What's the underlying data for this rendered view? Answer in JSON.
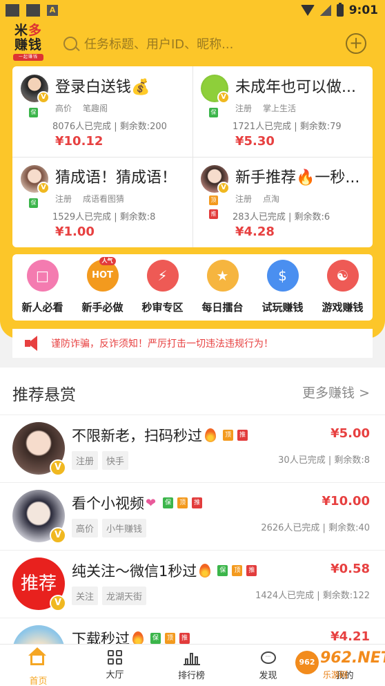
{
  "status_bar": {
    "time": "9:01"
  },
  "app": {
    "logo_line1a": "米",
    "logo_line1b": "多",
    "logo_line2": "赚钱",
    "logo_sub": "一起赚钱"
  },
  "search": {
    "placeholder": "任务标题、用户ID、昵称..."
  },
  "tasks": [
    {
      "title": "登录白送钱💰",
      "tag1": "高价",
      "tag2": "笔趣阁",
      "stats": "8076人已完成 | 剩余数:200",
      "price": "¥10.12",
      "badges": [
        "保"
      ]
    },
    {
      "title": "未成年也可以做...",
      "tag1": "注册",
      "tag2": "掌上生活",
      "stats": "1721人已完成 | 剩余数:79",
      "price": "¥5.30",
      "badges": [
        "保"
      ]
    },
    {
      "title": "猜成语！猜成语！",
      "tag1": "注册",
      "tag2": "成语看图猜",
      "stats": "1529人已完成 | 剩余数:8",
      "price": "¥1.00",
      "badges": [
        "保"
      ]
    },
    {
      "title": "新手推荐🔥一秒...",
      "tag1": "注册",
      "tag2": "点淘",
      "stats": "283人已完成 | 剩余数:6",
      "price": "¥4.28",
      "badges": [
        "顶",
        "推"
      ]
    }
  ],
  "categories": [
    {
      "label": "新人必看",
      "color": "#f47bb0"
    },
    {
      "label": "新手必做",
      "color": "#f39a1e",
      "hot": "HOT",
      "pill": "人气"
    },
    {
      "label": "秒审专区",
      "color": "#ee5a55"
    },
    {
      "label": "每日擂台",
      "color": "#f6b53f"
    },
    {
      "label": "试玩赚钱",
      "color": "#4a8ff0"
    },
    {
      "label": "游戏赚钱",
      "color": "#ee5a55"
    }
  ],
  "notice": {
    "text": "谨防诈骗，反诈须知！严厉打击一切违法违规行为！"
  },
  "recommend": {
    "title": "推荐悬赏",
    "more": "更多赚钱 >",
    "items": [
      {
        "title": "不限新老，扫码秒过",
        "tag1": "注册",
        "tag2": "快手",
        "price": "¥5.00",
        "stats": "30人已完成 | 剩余数:8",
        "badges": [
          "顶",
          "推"
        ]
      },
      {
        "title": "看个小视频",
        "tag1": "高价",
        "tag2": "小牛赚钱",
        "price": "¥10.00",
        "stats": "2626人已完成 | 剩余数:40",
        "badges": [
          "保",
          "顶",
          "推"
        ]
      },
      {
        "title": "纯关注～微信1秒过",
        "tag1": "关注",
        "tag2": "龙湖天街",
        "price": "¥0.58",
        "stats": "1424人已完成 | 剩余数:122",
        "badges": [
          "保",
          "顶",
          "推"
        ],
        "avatar_text": "推荐"
      },
      {
        "title": "下载秒过",
        "price": "¥4.21",
        "badges": [
          "保",
          "顶",
          "推"
        ]
      }
    ]
  },
  "tabs": [
    {
      "label": "首页"
    },
    {
      "label": "大厅"
    },
    {
      "label": "排行榜"
    },
    {
      "label": "发现"
    },
    {
      "label": "我的"
    }
  ],
  "watermark": {
    "text": "962.NET",
    "sub": "乐游网",
    "circle": "962"
  }
}
